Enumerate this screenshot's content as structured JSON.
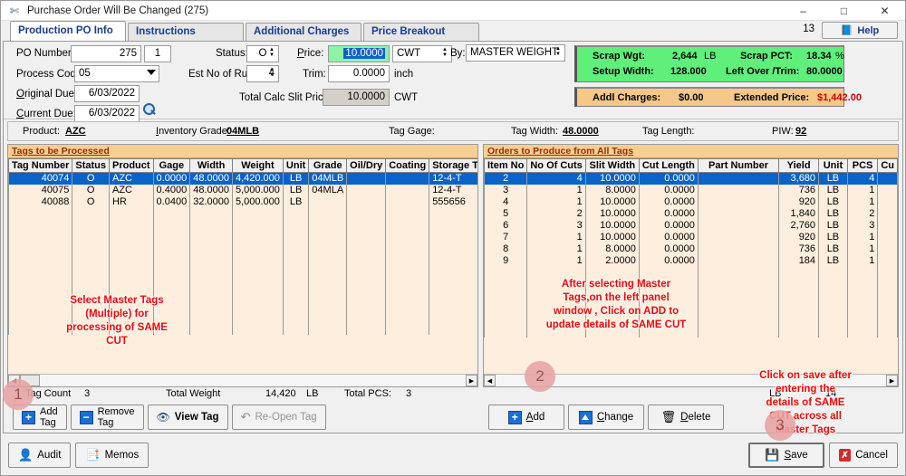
{
  "window": {
    "title": "Purchase Order Will Be Changed  (275)",
    "app_icon": "scissors-icon",
    "minimize": "–",
    "maximize": "□",
    "close": "✕"
  },
  "tabs": [
    {
      "label": "Production PO Info",
      "active": true
    },
    {
      "label": "Instructions",
      "active": false
    },
    {
      "label": "Additional Charges",
      "active": false
    },
    {
      "label": "Price Breakout",
      "active": false
    }
  ],
  "tab_count": "13",
  "help_button": "Help",
  "form": {
    "po_number_label": "PO Number:",
    "po_number_value": "275",
    "po_release_value": "1",
    "process_code_label": "Process Code:",
    "process_code_value": "05",
    "original_due_label": "Original Due:",
    "original_due_value": "6/03/2022",
    "current_due_label": "Current Due:",
    "current_due_value": "6/03/2022",
    "status_label": "Status:",
    "status_value": "O",
    "est_runs_label": "Est No of Runs:",
    "est_runs_value": "4",
    "price_label": "Price:",
    "price_value": "10.0000",
    "price_uom": "CWT",
    "trim_label": "Trim:",
    "trim_value": "0.0000",
    "trim_uom": "inch",
    "total_calc_label": "Total Calc Slit Price:",
    "total_calc_value": "10.0000",
    "total_calc_uom": "CWT",
    "by_label": "By:",
    "by_value": "MASTER WEIGHT"
  },
  "stats": {
    "scrap_wgt_label": "Scrap Wgt:",
    "scrap_wgt_value": "2,644",
    "scrap_wgt_unit": "LB",
    "scrap_pct_label": "Scrap PCT:",
    "scrap_pct_value": "18.34",
    "scrap_pct_unit": "%",
    "setup_width_label": "Setup Width:",
    "setup_width_value": "128.000",
    "leftover_label": "Left Over /Trim:",
    "leftover_value": "80.0000",
    "addl_charges_label": "Addl Charges:",
    "addl_charges_value": "$0.00",
    "extended_price_label": "Extended Price:",
    "extended_price_value": "$1,442.00",
    "extended_price_color": "#d40000",
    "green_bg": "#5ef07a",
    "amber_bg": "#f5c889"
  },
  "product_strip": {
    "product_label": "Product:",
    "product_value": "AZC",
    "inventory_grade_label": "Inventory Grade:",
    "inventory_grade_value": "04MLB",
    "tag_gage_label": "Tag Gage:",
    "tag_gage_value": "",
    "tag_width_label": "Tag Width:",
    "tag_width_value": "48.0000",
    "tag_length_label": "Tag Length:",
    "tag_length_value": "",
    "piw_label": "PIW:",
    "piw_value": "92"
  },
  "left_grid": {
    "title": "Tags to be Processed",
    "columns": [
      "Tag Number",
      "Status",
      "Product",
      "Gage",
      "Width",
      "Weight",
      "Unit",
      "Grade",
      "Oil/Dry",
      "Coating",
      "Storage Tag"
    ],
    "rows": [
      {
        "selected": true,
        "cells": [
          "40074",
          "O",
          "AZC",
          "0.0000",
          "48.0000",
          "4,420.000",
          "LB",
          "04MLB",
          "",
          "",
          "12-4-T"
        ]
      },
      {
        "selected": false,
        "cells": [
          "40075",
          "O",
          "AZC",
          "0.4000",
          "48.0000",
          "5,000.000",
          "LB",
          "04MLA",
          "",
          "",
          "12-4-T"
        ]
      },
      {
        "selected": false,
        "cells": [
          "40088",
          "O",
          "HR",
          "0.0400",
          "32.0000",
          "5,000.000",
          "LB",
          "",
          "",
          "",
          "555656"
        ]
      }
    ],
    "summary": {
      "tag_count_label": "Tag Count",
      "tag_count_value": "3",
      "total_weight_label": "Total Weight",
      "total_weight_value": "14,420",
      "total_weight_unit": "LB",
      "total_pcs_label": "Total PCS:",
      "total_pcs_value": "3"
    },
    "buttons": [
      {
        "name": "add-tag",
        "line1": "Add",
        "line2": "Tag",
        "icon": "plus-square-icon",
        "enabled": true
      },
      {
        "name": "remove-tag",
        "line1": "Remove",
        "line2": "Tag",
        "icon": "minus-square-icon",
        "enabled": true
      },
      {
        "name": "view-tag",
        "line1": "View Tag",
        "line2": "",
        "icon": "eye-icon",
        "enabled": true
      },
      {
        "name": "re-open-tag",
        "line1": "Re-Open Tag",
        "line2": "",
        "icon": "undo-icon",
        "enabled": false
      }
    ]
  },
  "right_grid": {
    "title": "Orders to Produce from All Tags",
    "columns": [
      "Item No",
      "No Of Cuts",
      "Slit Width",
      "Cut Length",
      "Part Number",
      "Yield",
      "Unit",
      "PCS",
      "Cu"
    ],
    "rows": [
      {
        "selected": true,
        "cells": [
          "2",
          "4",
          "10.0000",
          "0.0000",
          "",
          "3,680",
          "LB",
          "4",
          ""
        ]
      },
      {
        "selected": false,
        "cells": [
          "3",
          "1",
          "8.0000",
          "0.0000",
          "",
          "736",
          "LB",
          "1",
          ""
        ]
      },
      {
        "selected": false,
        "cells": [
          "4",
          "1",
          "10.0000",
          "0.0000",
          "",
          "920",
          "LB",
          "1",
          ""
        ]
      },
      {
        "selected": false,
        "cells": [
          "5",
          "2",
          "10.0000",
          "0.0000",
          "",
          "1,840",
          "LB",
          "2",
          ""
        ]
      },
      {
        "selected": false,
        "cells": [
          "6",
          "3",
          "10.0000",
          "0.0000",
          "",
          "2,760",
          "LB",
          "3",
          ""
        ]
      },
      {
        "selected": false,
        "cells": [
          "7",
          "1",
          "10.0000",
          "0.0000",
          "",
          "920",
          "LB",
          "1",
          ""
        ]
      },
      {
        "selected": false,
        "cells": [
          "8",
          "1",
          "8.0000",
          "0.0000",
          "",
          "736",
          "LB",
          "1",
          ""
        ]
      },
      {
        "selected": false,
        "cells": [
          "9",
          "1",
          "2.0000",
          "0.0000",
          "",
          "184",
          "LB",
          "1",
          ""
        ]
      }
    ],
    "summary": {
      "unit": "LB",
      "count": "14"
    },
    "buttons": [
      {
        "name": "add",
        "label": "Add",
        "icon": "plus-square-icon"
      },
      {
        "name": "change",
        "label": "Change",
        "icon": "triangle-square-icon"
      },
      {
        "name": "delete",
        "label": "Delete",
        "icon": "trash-icon"
      }
    ]
  },
  "annotations": [
    {
      "id": "a1",
      "lines": [
        "Select Master Tags",
        "(Multiple) for",
        "processing of SAME",
        "CUT"
      ]
    },
    {
      "id": "a2",
      "lines": [
        "After selecting Master",
        "Tags,on the left panel",
        "window , Click on ADD to",
        "update details of SAME CUT"
      ]
    },
    {
      "id": "a3",
      "lines": [
        "Click on save after",
        "entering the",
        "details of SAME",
        "CUT across all",
        "Master Tags"
      ]
    }
  ],
  "bubbles": [
    "1",
    "2",
    "3"
  ],
  "footer": {
    "audit_label": "Audit",
    "memos_label": "Memos",
    "save_label": "Save",
    "cancel_label": "Cancel"
  }
}
